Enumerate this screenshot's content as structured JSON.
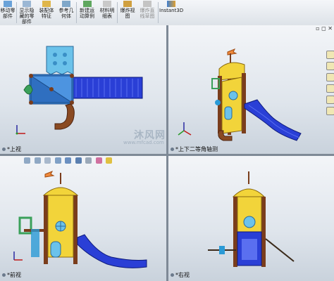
{
  "toolbar": {
    "buttons": [
      {
        "label": "移动零\n部件",
        "icon": "move-component-icon",
        "disabled": false
      },
      {
        "label": "显示隐\n藏的零\n部件",
        "icon": "show-hidden-icon",
        "disabled": false
      },
      {
        "label": "装配体\n特征",
        "icon": "assembly-feature-icon",
        "disabled": false
      },
      {
        "label": "参考几\n何体",
        "icon": "reference-geometry-icon",
        "disabled": false
      },
      {
        "label": "新建运\n动算例",
        "icon": "motion-study-icon",
        "disabled": false
      },
      {
        "label": "材料明\n细表",
        "icon": "bom-icon",
        "disabled": false
      },
      {
        "label": "爆炸视\n图",
        "icon": "exploded-view-icon",
        "disabled": false
      },
      {
        "label": "爆炸直\n线草图",
        "icon": "explode-line-icon",
        "disabled": true
      },
      {
        "label": "Instant3D",
        "icon": "instant3d-icon",
        "disabled": false
      }
    ]
  },
  "viewports": {
    "top_left": {
      "label": "*上视"
    },
    "top_right": {
      "label": "*上下二等角轴测"
    },
    "bottom_left": {
      "label": "*前视"
    },
    "bottom_right": {
      "label": "*右视"
    }
  },
  "watermark": {
    "text": "沐风网",
    "url": "www.mfcad.com"
  },
  "colors": {
    "slide_blue": "#2a3fd6",
    "roof_yellow": "#f2d43a",
    "frame_brown": "#7a3d1c",
    "panel_cyan": "#6bc2ea",
    "rail_green": "#3aa05a",
    "flag_orange": "#f08a3c"
  }
}
